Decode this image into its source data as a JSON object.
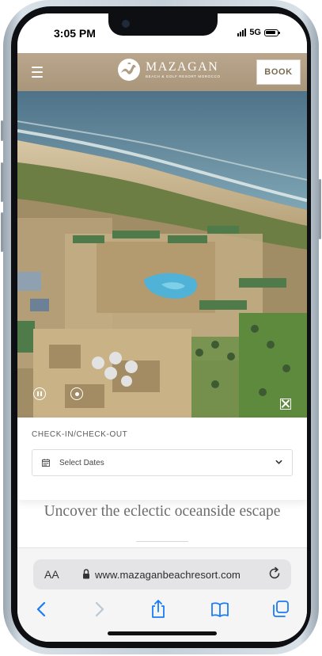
{
  "status_bar": {
    "time": "3:05 PM",
    "network": "5G"
  },
  "site_header": {
    "brand_name": "MAZAGAN",
    "brand_subtitle": "BEACH & GOLF RESORT MOROCCO",
    "book_label": "BOOK"
  },
  "booking": {
    "label": "CHECK-IN/CHECK-OUT",
    "select_placeholder": "Select Dates"
  },
  "content": {
    "tagline": "Uncover the eclectic oceanside escape"
  },
  "browser": {
    "aa_label": "AA",
    "url": "www.mazaganbeachresort.com"
  },
  "colors": {
    "header_bg": "#b09e84",
    "book_text": "#7b6a53",
    "safari_icon": "#1a7cf5",
    "tagline": "#6c6c6c"
  },
  "icons": {
    "menu": "hamburger-menu-icon",
    "pause": "pause-icon",
    "sound": "sound-icon",
    "fullscreen": "fullscreen-icon",
    "calendar": "calendar-icon",
    "dropdown": "chevron-down-icon",
    "lock": "lock-icon",
    "reload": "reload-icon",
    "back": "back-icon",
    "forward": "forward-icon",
    "share": "share-icon",
    "bookmarks": "bookmarks-icon",
    "tabs": "tabs-icon"
  }
}
